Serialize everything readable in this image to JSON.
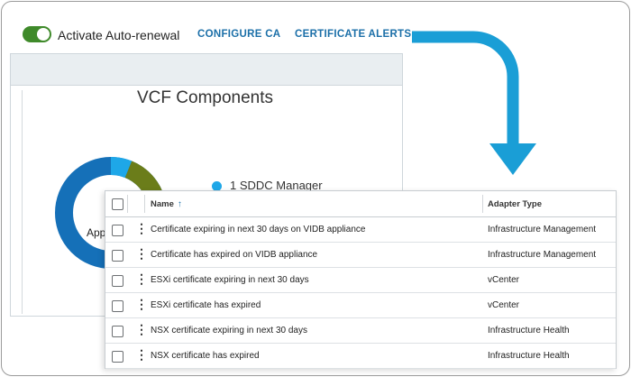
{
  "toolbar": {
    "auto_renewal_label": "Activate Auto-renewal",
    "auto_renewal_on": true,
    "configure_ca_label": "CONFIGURE CA",
    "certificate_alerts_label": "CERTIFICATE ALERTS"
  },
  "card": {
    "title": "VCF Components",
    "legend": [
      {
        "label": "1 SDDC Manager",
        "color": "#1ea7e8"
      }
    ],
    "donut_center_label": "App",
    "donut_colors": [
      "#1570b8",
      "#1ea7e8",
      "#6b7d1a"
    ]
  },
  "table": {
    "headers": {
      "name": "Name",
      "adapter_type": "Adapter Type"
    },
    "sort_icon": "arrow-up-icon",
    "rows": [
      {
        "name": "Certificate expiring in next 30 days on VIDB appliance",
        "adapter_type": "Infrastructure Management"
      },
      {
        "name": "Certificate has expired on VIDB appliance",
        "adapter_type": "Infrastructure Management"
      },
      {
        "name": "ESXi certificate expiring in next 30 days",
        "adapter_type": "vCenter"
      },
      {
        "name": "ESXi certificate has expired",
        "adapter_type": "vCenter"
      },
      {
        "name": "NSX certificate expiring in next 30 days",
        "adapter_type": "Infrastructure Health"
      },
      {
        "name": "NSX certificate has expired",
        "adapter_type": "Infrastructure Health"
      }
    ]
  },
  "colors": {
    "accent": "#1b6fa8",
    "toggle_on": "#3f8a2a",
    "arrow": "#1a9ed6"
  }
}
